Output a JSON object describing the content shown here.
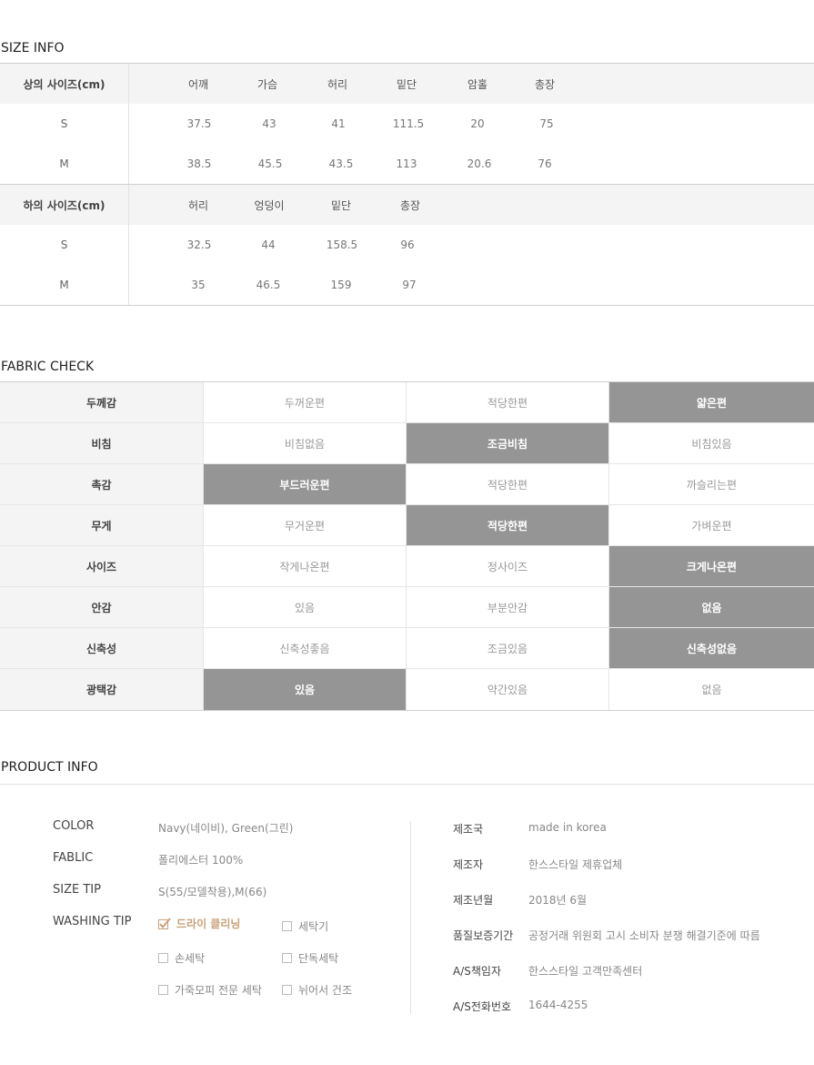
{
  "size_info": {
    "title": "SIZE INFO",
    "top": {
      "label": "상의 사이즈(cm)",
      "columns": [
        "어깨",
        "가슴",
        "허리",
        "밑단",
        "암홀",
        "총장"
      ],
      "rows": [
        {
          "size": "S",
          "values": [
            "37.5",
            "43",
            "41",
            "111.5",
            "20",
            "75"
          ]
        },
        {
          "size": "M",
          "values": [
            "38.5",
            "45.5",
            "43.5",
            "113",
            "20.6",
            "76"
          ]
        }
      ]
    },
    "bottom": {
      "label": "하의 사이즈(cm)",
      "columns": [
        "허리",
        "엉덩이",
        "밑단",
        "총장"
      ],
      "rows": [
        {
          "size": "S",
          "values": [
            "32.5",
            "44",
            "158.5",
            "96"
          ]
        },
        {
          "size": "M",
          "values": [
            "35",
            "46.5",
            "159",
            "97"
          ]
        }
      ]
    }
  },
  "fabric_check": {
    "title": "FABRIC CHECK",
    "rows": [
      {
        "name": "두께감",
        "options": [
          "두꺼운편",
          "적당한편",
          "얇은편"
        ],
        "selected": 2
      },
      {
        "name": "비침",
        "options": [
          "비침없음",
          "조금비침",
          "비침있음"
        ],
        "selected": 1
      },
      {
        "name": "촉감",
        "options": [
          "부드러운편",
          "적당한편",
          "까슬리는편"
        ],
        "selected": 0
      },
      {
        "name": "무게",
        "options": [
          "무거운편",
          "적당한편",
          "가벼운편"
        ],
        "selected": 1
      },
      {
        "name": "사이즈",
        "options": [
          "작게나온편",
          "정사이즈",
          "크게나온편"
        ],
        "selected": 2
      },
      {
        "name": "안감",
        "options": [
          "있음",
          "부분안감",
          "없음"
        ],
        "selected": 2
      },
      {
        "name": "신축성",
        "options": [
          "신축성좋음",
          "조금있음",
          "신축성없음"
        ],
        "selected": 2
      },
      {
        "name": "광택감",
        "options": [
          "있음",
          "약간있음",
          "없음"
        ],
        "selected": 0
      }
    ]
  },
  "product_info": {
    "title": "PRODUCT INFO",
    "left": {
      "color_label": "COLOR",
      "color_value": "Navy(네이비), Green(그린)",
      "fablic_label": "FABLIC",
      "fablic_value": "폴리에스터 100%",
      "size_tip_label": "SIZE TIP",
      "size_tip_value": "S(55/모델착용),M(66)",
      "washing_label": "WASHING TIP",
      "washing_options": [
        {
          "label": "드라이 클리닝",
          "checked": true
        },
        {
          "label": "세탁기",
          "checked": false
        },
        {
          "label": "손세탁",
          "checked": false
        },
        {
          "label": "단독세탁",
          "checked": false
        },
        {
          "label": "가죽모피 전문 세탁",
          "checked": false
        },
        {
          "label": "뉘어서 건조",
          "checked": false
        }
      ]
    },
    "right": [
      {
        "key": "제조국",
        "value": "made in korea"
      },
      {
        "key": "제조자",
        "value": "한스스타일 제휴업체"
      },
      {
        "key": "제조년월",
        "value": "2018년 6월"
      },
      {
        "key": "품질보증기간",
        "value": "공정거래 위원회 고시 소비자 분쟁 해결기준에 따름"
      },
      {
        "key": "A/S책임자",
        "value": "한스스타일 고객만족센터"
      },
      {
        "key": "A/S전화번호",
        "value": "1644-4255"
      }
    ]
  },
  "colors": {
    "selected_bg": "#959595",
    "label_bg": "#f4f4f4",
    "checked_text": "#c9a27a"
  }
}
